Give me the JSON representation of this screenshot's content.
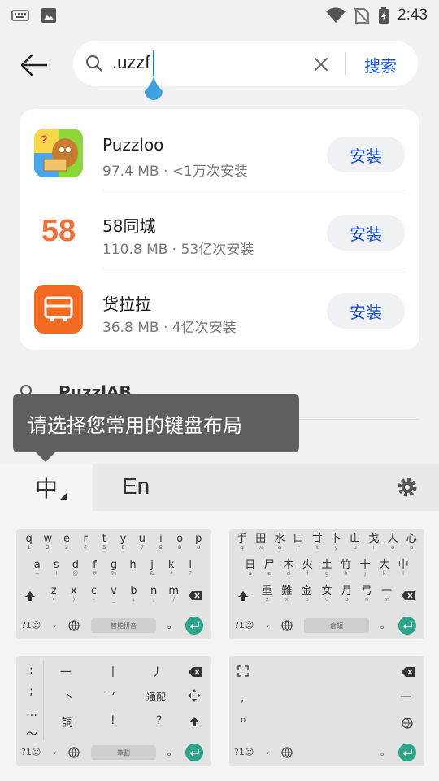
{
  "status_bar": {
    "time": "2:43",
    "left_icons": [
      "keyboard-icon",
      "image-icon"
    ],
    "right_icons": [
      "wifi-icon",
      "no-sim-icon",
      "battery-charging-icon"
    ]
  },
  "search": {
    "query": ".uzzf",
    "submit_label": "搜索"
  },
  "results": [
    {
      "name": "Puzzloo",
      "meta": "97.4 MB · <1万次安装",
      "install_label": "安装",
      "icon": "puzzloo-app-icon"
    },
    {
      "name": "58同城",
      "meta": "110.8 MB · 53亿次安装",
      "install_label": "安装",
      "icon": "58-app-icon",
      "icon_text": "58"
    },
    {
      "name": "货拉拉",
      "meta": "36.8 MB · 4亿次安装",
      "install_label": "安装",
      "icon": "huolala-app-icon"
    }
  ],
  "suggestion": {
    "text": "PuzzlAB"
  },
  "tooltip": {
    "text": "请选择您常用的键盘布局"
  },
  "keyboard": {
    "tab_zh": "中",
    "tab_en": "En",
    "qwerty": {
      "row1": [
        "q",
        "w",
        "e",
        "r",
        "t",
        "y",
        "u",
        "i",
        "o",
        "p"
      ],
      "row1_sub": [
        "1",
        "2",
        "3",
        "4",
        "5",
        "6",
        "7",
        "8",
        "9",
        "0"
      ],
      "row2": [
        "a",
        "s",
        "d",
        "f",
        "g",
        "h",
        "j",
        "k",
        "l"
      ],
      "row2_sub": [
        "~",
        "!",
        "@",
        "#",
        "%",
        "'",
        "&",
        "*",
        "?"
      ],
      "row3": [
        "z",
        "x",
        "c",
        "v",
        "b",
        "n",
        "m"
      ],
      "row3_sub": [
        "(",
        ")",
        "-",
        "_",
        ":",
        ";",
        "/"
      ],
      "sym_label": "?1☺",
      "comma": ",",
      "period": "。",
      "space_label": "智能拼音"
    },
    "cangjie": {
      "row1": [
        "手",
        "田",
        "水",
        "口",
        "廿",
        "卜",
        "山",
        "戈",
        "人",
        "心"
      ],
      "row1_sub": [
        "q",
        "w",
        "e",
        "r",
        "t",
        "y",
        "u",
        "i",
        "o",
        "p"
      ],
      "row2": [
        "日",
        "尸",
        "木",
        "火",
        "土",
        "竹",
        "十",
        "大",
        "中"
      ],
      "row2_sub": [
        "a",
        "s",
        "d",
        "f",
        "g",
        "h",
        "j",
        "k",
        "l"
      ],
      "row3": [
        "重",
        "難",
        "金",
        "女",
        "月",
        "弓",
        "一"
      ],
      "row3_sub": [
        "z",
        "x",
        "c",
        "v",
        "b",
        "n",
        "m"
      ],
      "sym_label": "?1☺",
      "comma": ",",
      "period": "。",
      "space_label": "倉頡"
    },
    "stroke": {
      "left_keys": [
        ":",
        ";",
        "…",
        "～"
      ],
      "strokes": [
        "一",
        "丨",
        "丿",
        "丶",
        "乛",
        "通配"
      ],
      "word_label": "詞",
      "exclaim": "!",
      "question": "?",
      "sym_label": "?1☺",
      "comma": ",",
      "period": "。",
      "space_label": "筆劃"
    },
    "handwriting": {
      "comma": ",",
      "period": "。",
      "sym_label": "?1☺"
    }
  }
}
